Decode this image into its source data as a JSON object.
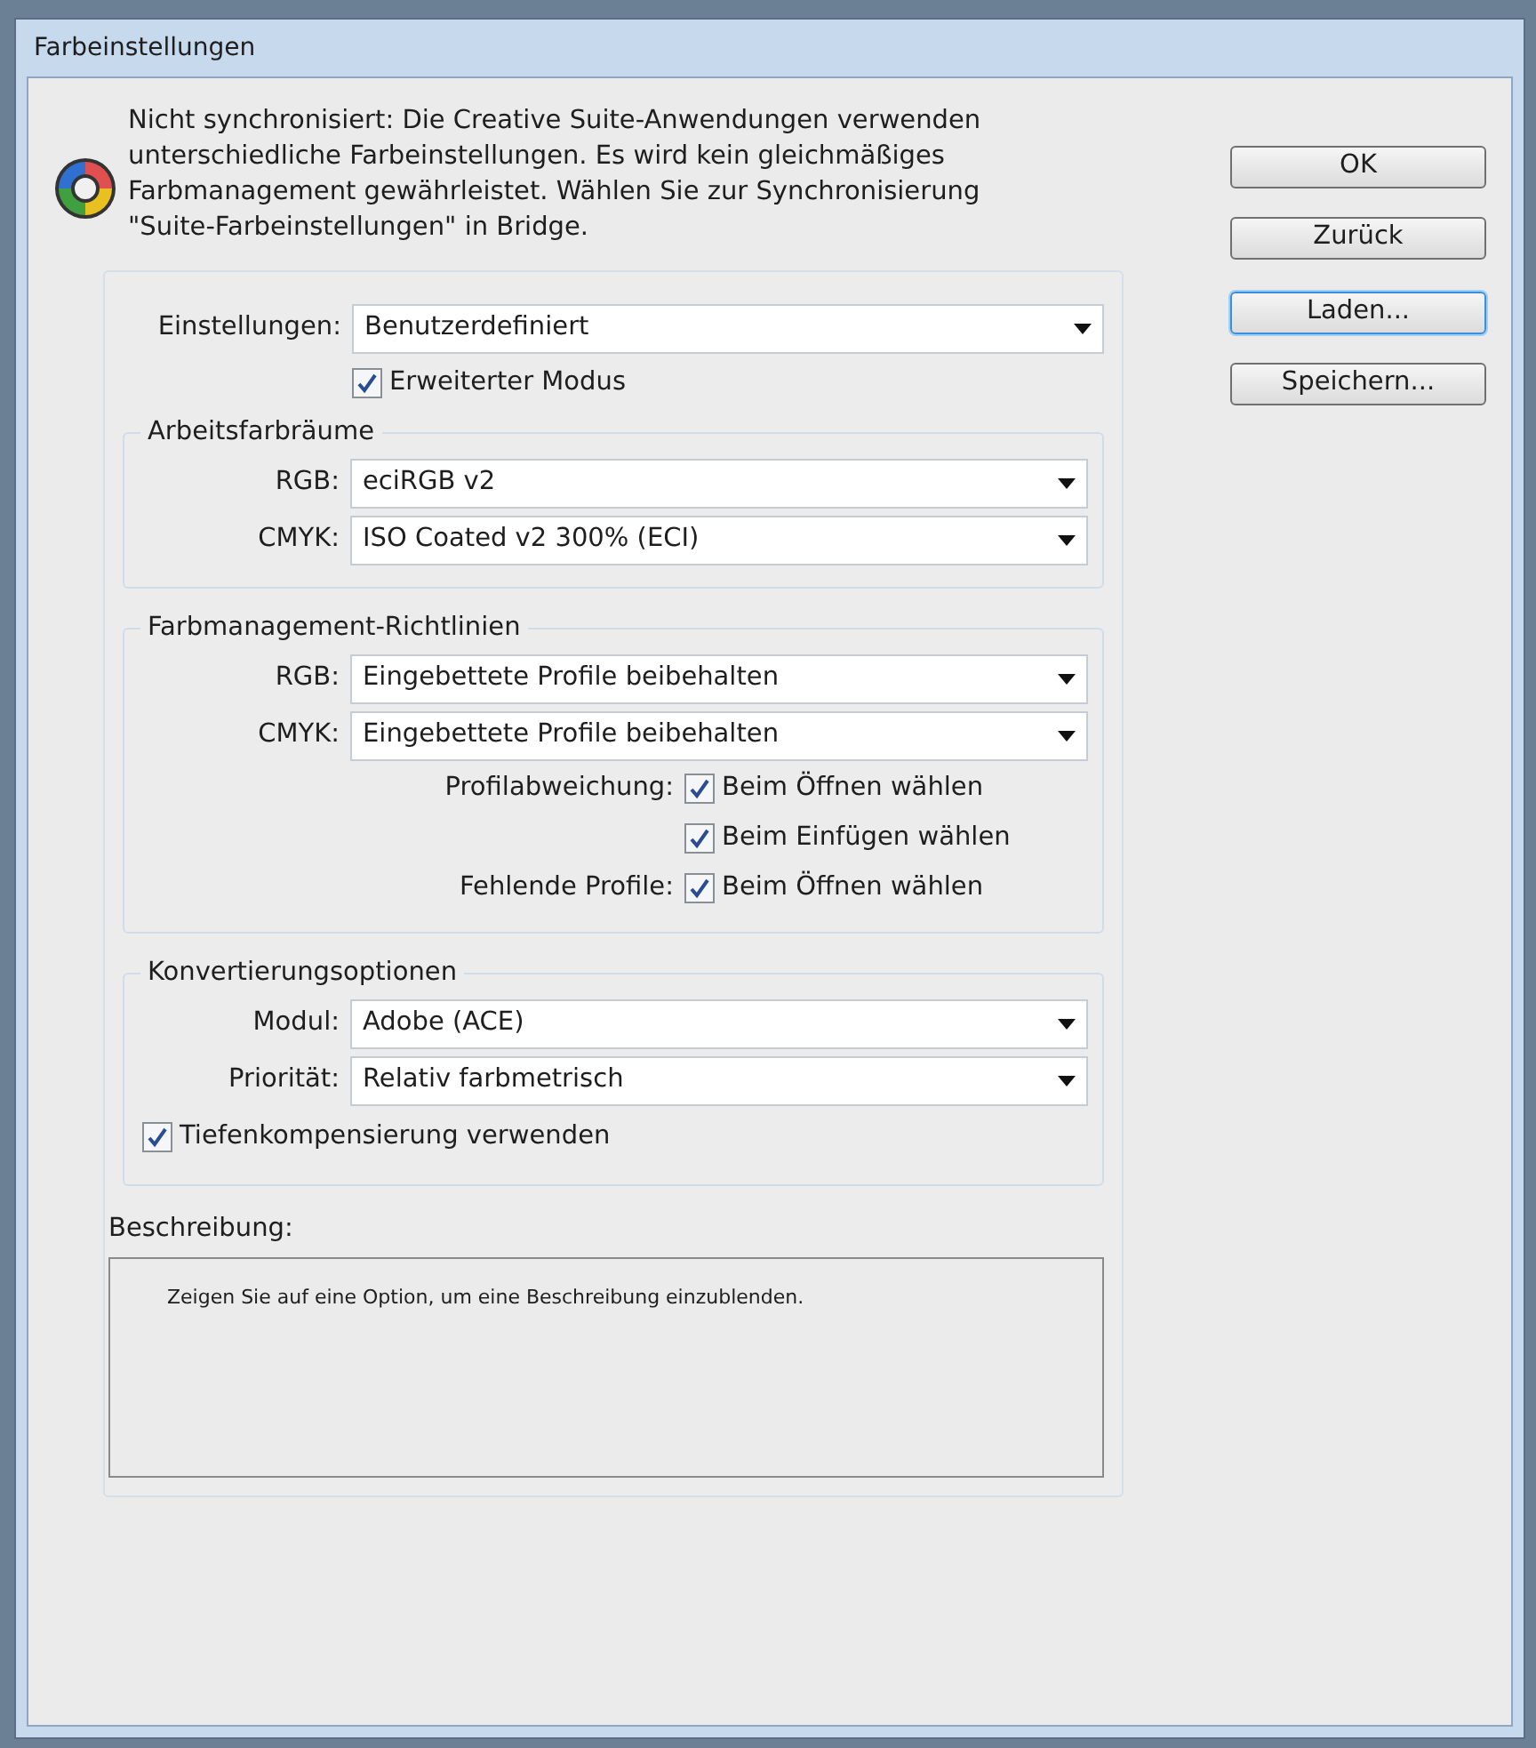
{
  "window": {
    "title": "Farbeinstellungen"
  },
  "message": "Nicht synchronisiert: Die Creative Suite-Anwendungen verwenden unterschiedliche Farbeinstellungen. Es wird kein gleichmäßiges Farbmanagement gewährleistet. Wählen Sie zur Synchronisierung \"Suite-Farbeinstellungen\" in Bridge.",
  "settings": {
    "label": "Einstellungen:",
    "value": "Benutzerdefiniert"
  },
  "advanced_mode": {
    "label": "Erweiterter Modus",
    "checked": true
  },
  "sections": [
    {
      "title": "Arbeitsfarbräume",
      "rows": [
        {
          "kind": "dropdown",
          "label": "RGB:",
          "value": "eciRGB v2"
        },
        {
          "kind": "dropdown",
          "label": "CMYK:",
          "value": "ISO Coated v2 300% (ECI)"
        }
      ]
    },
    {
      "title": "Farbmanagement-Richtlinien",
      "rows": [
        {
          "kind": "dropdown",
          "label": "RGB:",
          "value": "Eingebettete Profile beibehalten"
        },
        {
          "kind": "dropdown",
          "label": "CMYK:",
          "value": "Eingebettete Profile beibehalten"
        },
        {
          "kind": "labeled_checkbox",
          "label": "Profilabweichung:",
          "text": "Beim Öffnen wählen",
          "checked": true
        },
        {
          "kind": "labeled_checkbox",
          "text": "Beim Einfügen wählen",
          "checked": true
        },
        {
          "kind": "labeled_checkbox",
          "label": "Fehlende Profile:",
          "text": "Beim Öffnen wählen",
          "checked": true
        }
      ]
    },
    {
      "title": "Konvertierungsoptionen",
      "rows": [
        {
          "kind": "dropdown",
          "label": "Modul:",
          "value": "Adobe (ACE)"
        },
        {
          "kind": "dropdown",
          "label": "Priorität:",
          "value": "Relativ farbmetrisch"
        },
        {
          "kind": "checkbox",
          "text": "Tiefenkompensierung verwenden",
          "checked": true
        }
      ]
    }
  ],
  "description": {
    "label": "Beschreibung:",
    "text": "Zeigen Sie auf eine Option, um eine Beschreibung einzublenden."
  },
  "buttons": [
    {
      "label": "OK",
      "focused": false
    },
    {
      "label": "Zurück",
      "focused": false
    },
    {
      "label": "Laden...",
      "focused": true
    },
    {
      "label": "Speichern...",
      "focused": false
    }
  ]
}
